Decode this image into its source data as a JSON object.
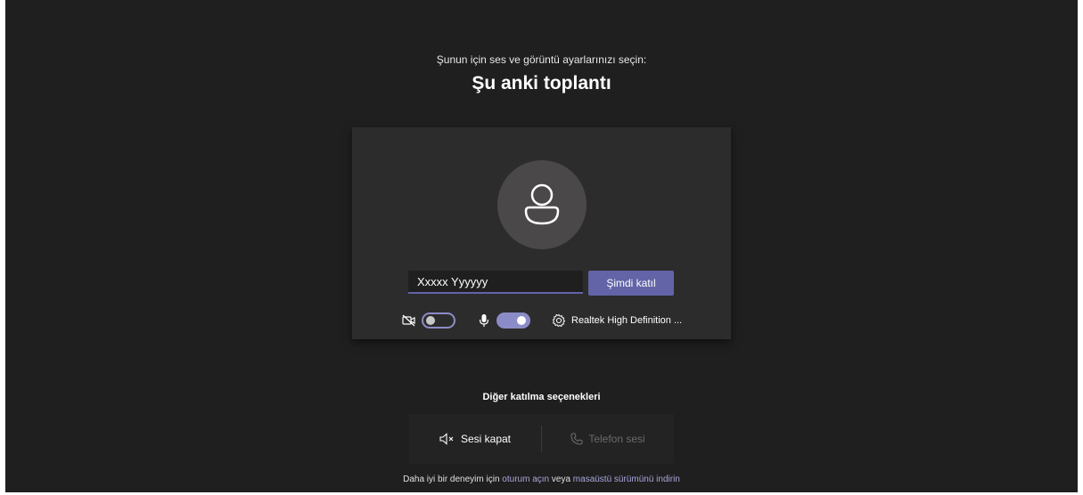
{
  "header": {
    "subtitle": "Şunun için ses ve görüntü ayarlarınızı seçin:",
    "title": "Şu anki toplantı"
  },
  "prejoin": {
    "name_value": "Xxxxx Yyyyyy",
    "join_label": "Şimdi katıl",
    "camera_on": false,
    "mic_on": true,
    "device_label": "Realtek High Definition ..."
  },
  "other": {
    "heading": "Diğer katılma seçenekleri",
    "mute_label": "Sesi kapat",
    "phone_label": "Telefon sesi"
  },
  "footer": {
    "prefix": "Daha iyi bir deneyim için",
    "signin_link": "oturum açın",
    "middle": "veya",
    "download_link": "masaüstü sürümünü indirin"
  },
  "colors": {
    "accent": "#6264a7",
    "background": "#201f1f",
    "card": "#2d2c2c"
  }
}
